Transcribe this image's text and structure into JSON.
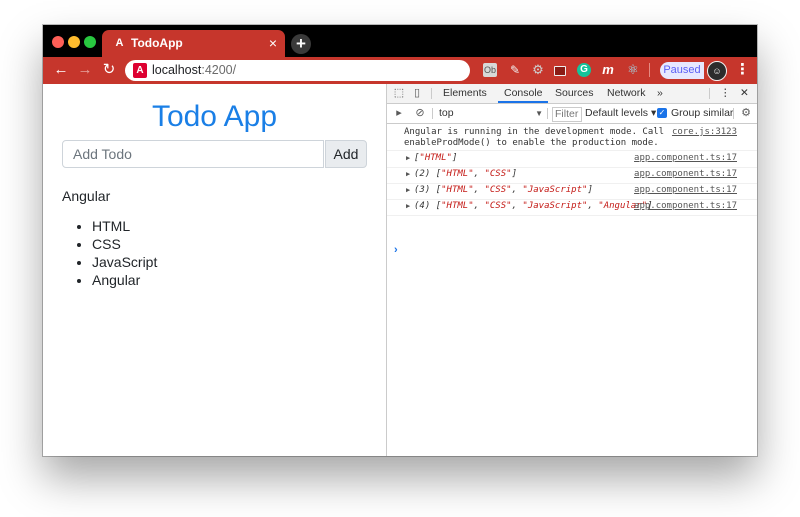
{
  "browser": {
    "tab_title": "TodoApp",
    "tab_close": "×",
    "new_tab": "+",
    "tab_icon_glyph": "A",
    "url_host": "localhost",
    "url_rest": ":4200/",
    "nav": {
      "back": "←",
      "forward": "→",
      "reload": "↻"
    },
    "extensions": {
      "ext1": "Ob",
      "ext2": "✎",
      "ext3": "⚙",
      "ext5": "G",
      "ext6": "m",
      "ext7": "⚛"
    },
    "paused_label": "Paused",
    "menu": "⋮"
  },
  "app": {
    "title": "Todo App",
    "input_placeholder": "Add Todo",
    "add_button": "Add",
    "list_heading": "Angular",
    "todos": [
      "HTML",
      "CSS",
      "JavaScript",
      "Angular"
    ]
  },
  "devtools": {
    "tabs": [
      "Elements",
      "Console",
      "Sources",
      "Network"
    ],
    "active_tab": "Console",
    "more_tabs": "»",
    "menu": "⋮",
    "close": "✕",
    "context": "top",
    "filter_placeholder": "Filter",
    "levels": "Default levels ▾",
    "group_similar": "Group similar",
    "messages": [
      {
        "text": "Angular is running in the development mode. Call\nenableProdMode() to enable the production mode.",
        "source": "core.js:3123"
      },
      {
        "count": "",
        "items": [
          "\"HTML\""
        ],
        "source": "app.component.ts:17"
      },
      {
        "count": "(2) ",
        "items": [
          "\"HTML\"",
          "\"CSS\""
        ],
        "source": "app.component.ts:17"
      },
      {
        "count": "(3) ",
        "items": [
          "\"HTML\"",
          "\"CSS\"",
          "\"JavaScript\""
        ],
        "source": "app.component.ts:17"
      },
      {
        "count": "(4) ",
        "items": [
          "\"HTML\"",
          "\"CSS\"",
          "\"JavaScript\"",
          "\"Angular\""
        ],
        "source": "app.component.ts:17"
      }
    ],
    "prompt": "›"
  },
  "colors": {
    "browser_red": "#c6362c",
    "title_blue": "#1a7fe6",
    "devtools_accent": "#1a73e8",
    "string_red": "#c41a16"
  }
}
